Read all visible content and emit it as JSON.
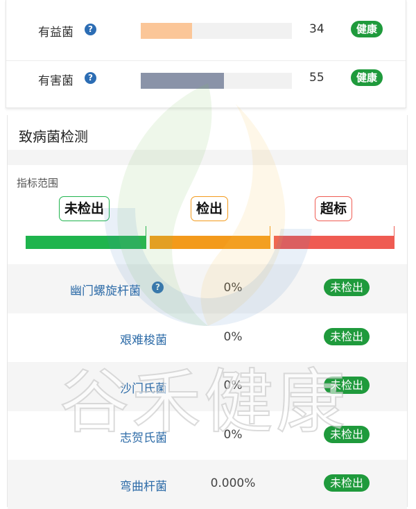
{
  "metrics": [
    {
      "label": "有益菌",
      "value": "34",
      "status": "健康",
      "level": 0.34,
      "color": "#fbc698"
    },
    {
      "label": "有害菌",
      "value": "55",
      "status": "健康",
      "level": 0.55,
      "color": "#8a93a8"
    }
  ],
  "help_glyph": "?",
  "section": {
    "title": "致病菌检测",
    "range_title": "指标范围",
    "legend": [
      {
        "label": "未检出",
        "color": "#1fb44d"
      },
      {
        "label": "检出",
        "color": "#f39a1b"
      },
      {
        "label": "超标",
        "color": "#ef5b52"
      }
    ]
  },
  "pathogens": [
    {
      "name": "幽门螺旋杆菌",
      "value": "0%",
      "status": "未检出",
      "has_help": true
    },
    {
      "name": "艰难梭菌",
      "value": "0%",
      "status": "未检出",
      "has_help": false
    },
    {
      "name": "沙门氏菌",
      "value": "0%",
      "status": "未检出",
      "has_help": false
    },
    {
      "name": "志贺氏菌",
      "value": "0%",
      "status": "未检出",
      "has_help": false
    },
    {
      "name": "弯曲杆菌",
      "value": "0.000%",
      "status": "未检出",
      "has_help": false
    }
  ],
  "watermark": {
    "text": "谷禾健康",
    "icon": "flame-leaf-logo"
  },
  "colors": {
    "badge_green": "#1f9a3c",
    "link_blue": "#2e6ca8",
    "help_blue": "#2c6db4"
  }
}
